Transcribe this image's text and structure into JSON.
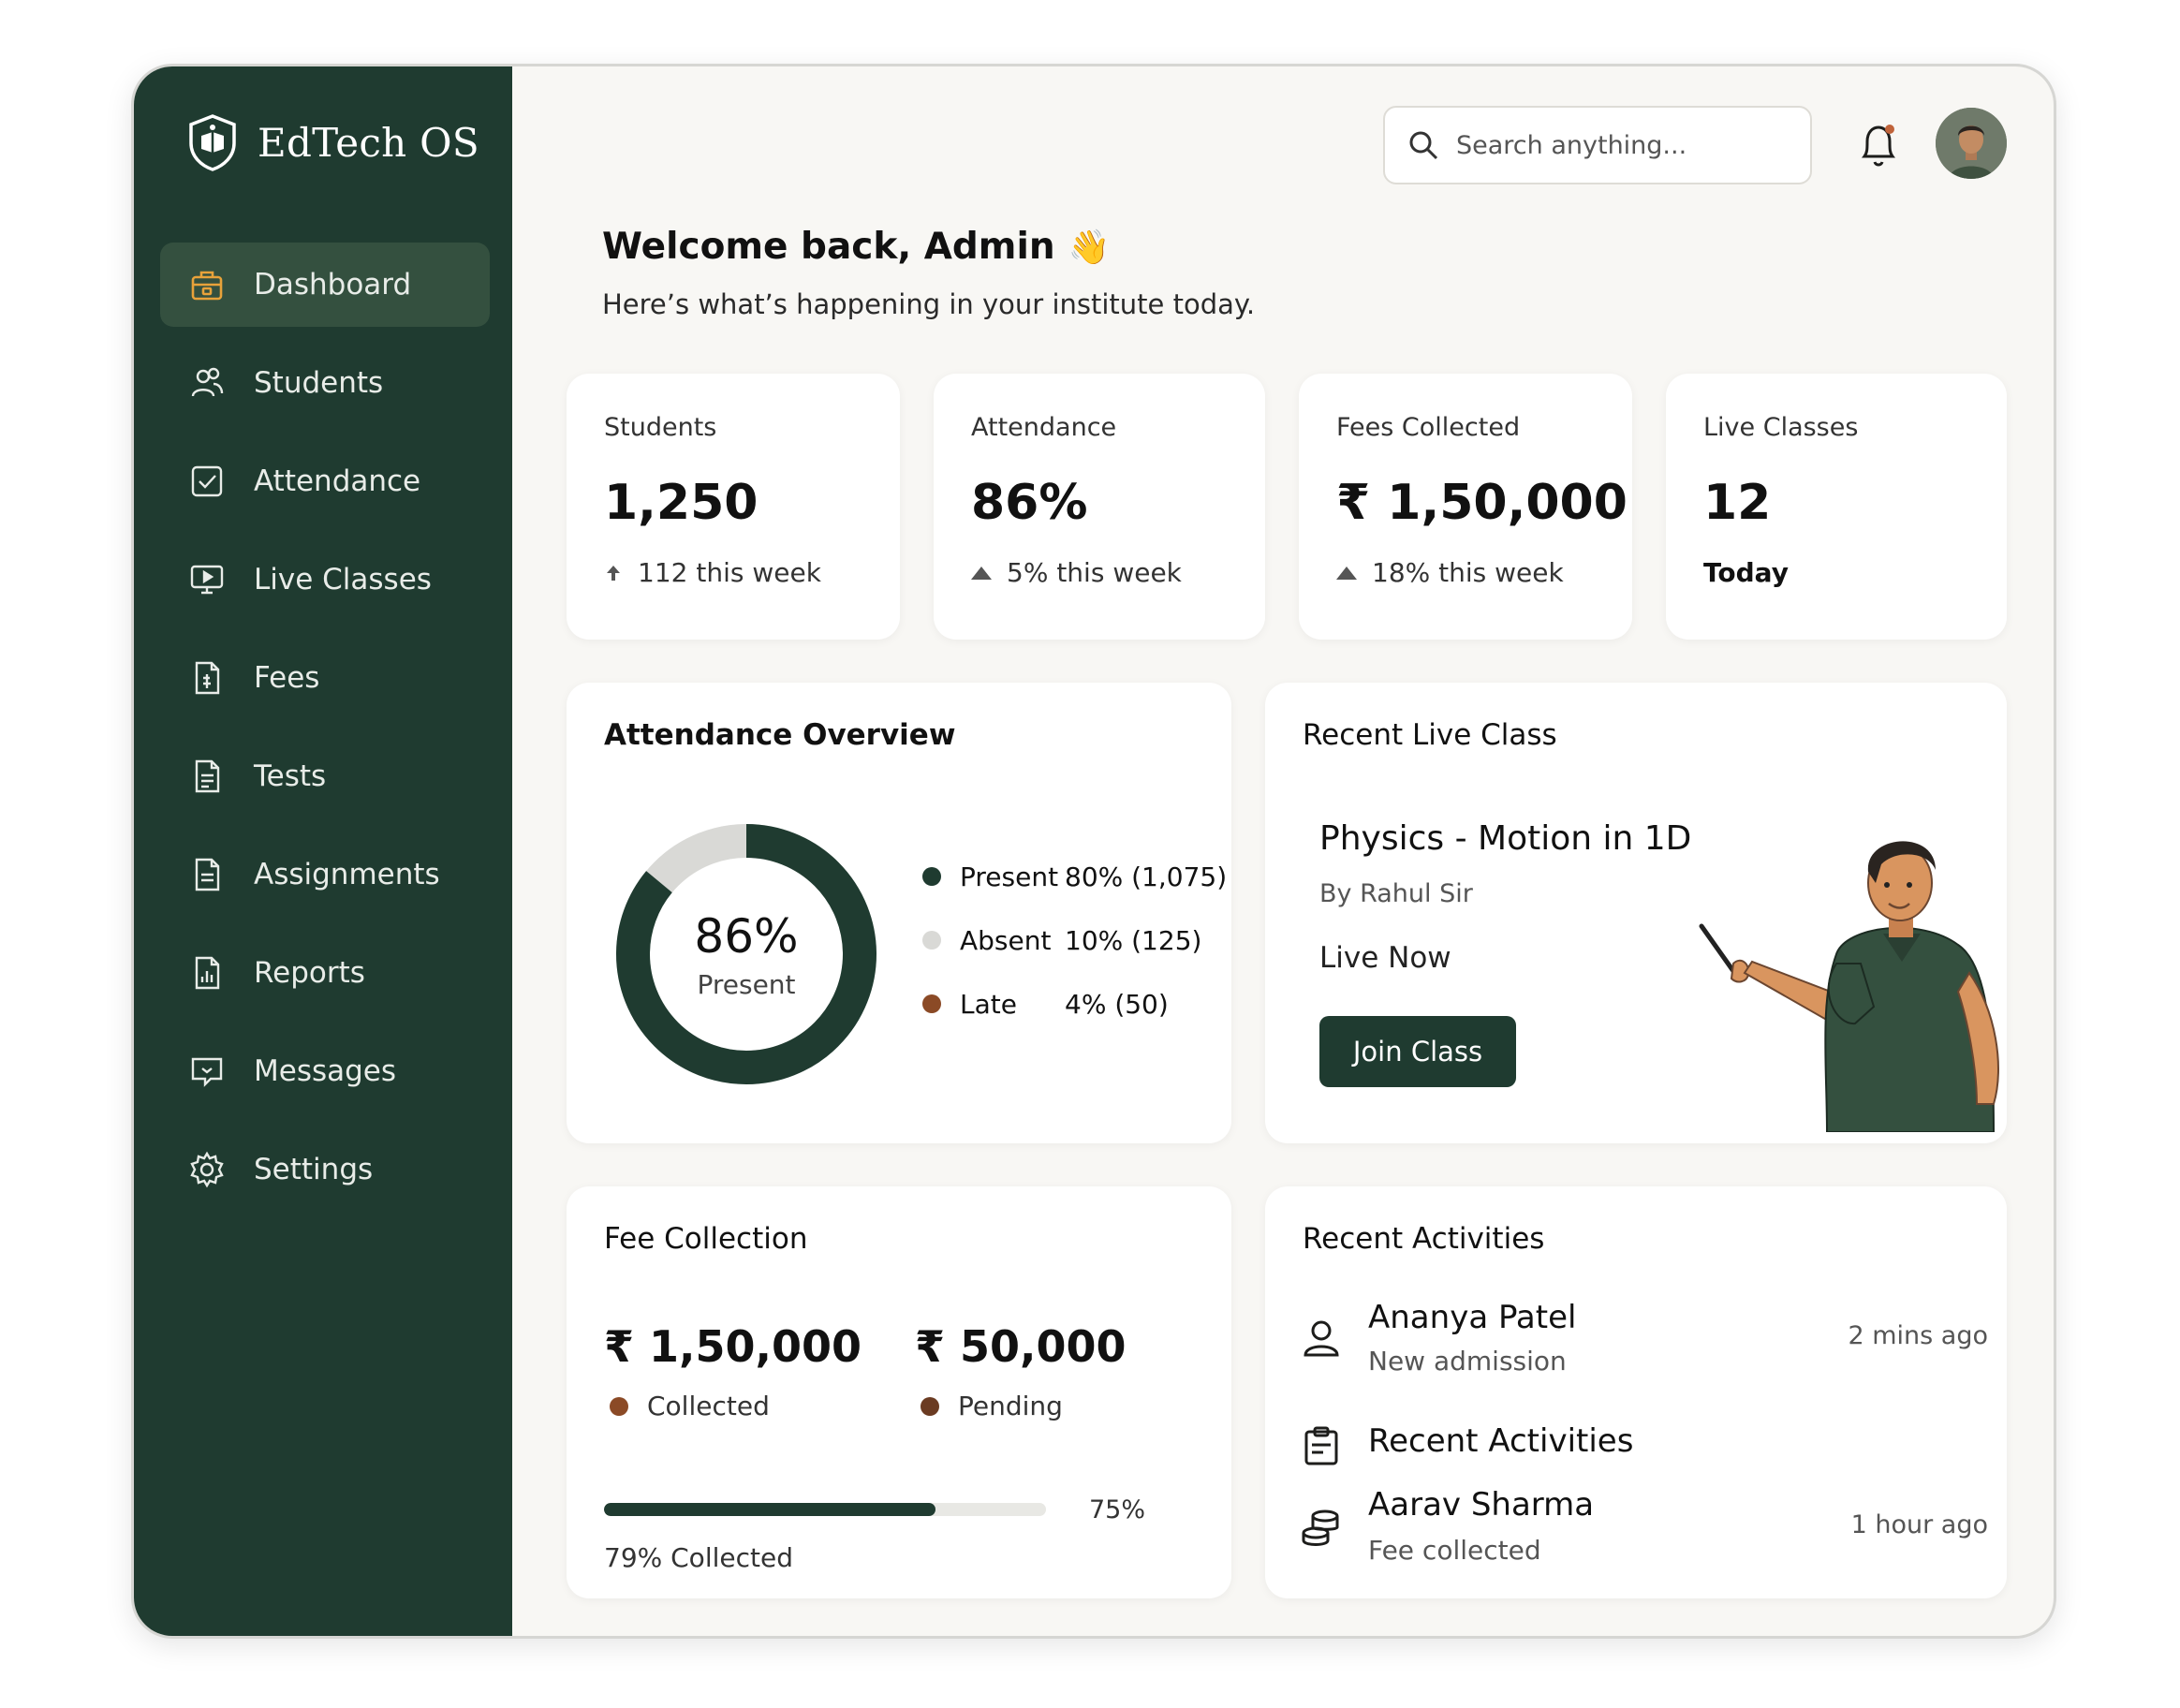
{
  "brand": {
    "name": "EdTech OS"
  },
  "sidebar": {
    "items": [
      {
        "label": "Dashboard",
        "icon": "dashboard-icon",
        "active": true
      },
      {
        "label": "Students",
        "icon": "students-icon"
      },
      {
        "label": "Attendance",
        "icon": "attendance-icon"
      },
      {
        "label": "Live Classes",
        "icon": "live-classes-icon"
      },
      {
        "label": "Fees",
        "icon": "fees-icon"
      },
      {
        "label": "Tests",
        "icon": "tests-icon"
      },
      {
        "label": "Assignments",
        "icon": "assignments-icon"
      },
      {
        "label": "Reports",
        "icon": "reports-icon"
      },
      {
        "label": "Messages",
        "icon": "messages-icon"
      },
      {
        "label": "Settings",
        "icon": "settings-icon"
      }
    ]
  },
  "header": {
    "search_placeholder": "Search anything..."
  },
  "welcome": {
    "title": "Welcome back, Admin",
    "emoji": "👋",
    "subtitle": "Here’s what’s happening in your institute today."
  },
  "stats": [
    {
      "label": "Students",
      "value": "1,250",
      "delta": "112 this week"
    },
    {
      "label": "Attendance",
      "value": "86%",
      "delta": "5% this week"
    },
    {
      "label": "Fees Collected",
      "value": "₹ 1,50,000",
      "delta": "18% this week"
    },
    {
      "label": "Live Classes",
      "value": "12",
      "delta": "Today"
    }
  ],
  "attendance_overview": {
    "title": "Attendance Overview",
    "center_value": "86%",
    "center_label": "Present",
    "donut_fraction": 0.86,
    "legend": [
      {
        "name": "Present",
        "value": "80% (1,075)",
        "color": "#1f3b30"
      },
      {
        "name": "Absent",
        "value": "10% (125)",
        "color": "#d9d9d6"
      },
      {
        "name": "Late",
        "value": "4% (50)",
        "color": "#8b4a26"
      }
    ]
  },
  "live_class": {
    "title": "Recent Live Class",
    "class_name": "Physics - Motion in 1D",
    "teacher": "By Rahul Sir",
    "status": "Live Now",
    "button": "Join Class"
  },
  "fee_collection": {
    "title": "Fee Collection",
    "collected_amount": "₹ 1,50,000",
    "collected_label": "Collected",
    "pending_amount": "₹ 50,000",
    "pending_label": "Pending",
    "progress_fraction": 0.75,
    "progress_pct": "75%",
    "progress_label": "79% Collected"
  },
  "recent_activities": {
    "title": "Recent Activities",
    "items": [
      {
        "name": "Ananya Patel",
        "sub": "New admission",
        "time": "2 mins ago",
        "icon": "user-icon"
      },
      {
        "name": "Recent Activities",
        "sub": "",
        "time": "",
        "icon": "clipboard-icon"
      },
      {
        "name": "Aarav Sharma",
        "sub": "Fee collected",
        "time": "1 hour ago",
        "icon": "coins-icon"
      }
    ]
  }
}
